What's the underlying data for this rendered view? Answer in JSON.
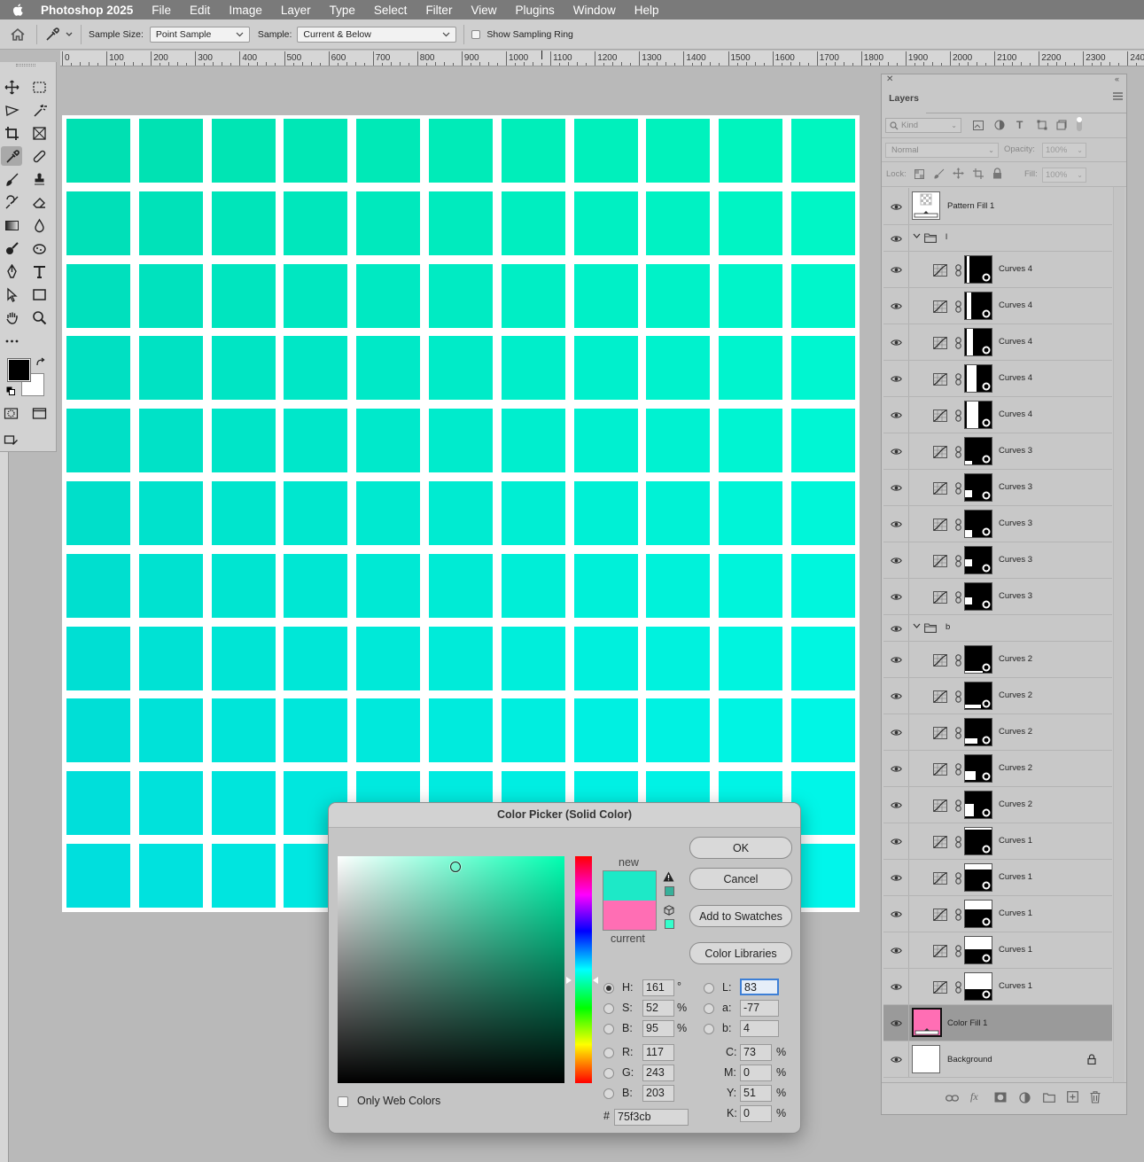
{
  "menubar": {
    "app": "Photoshop 2025",
    "items": [
      "File",
      "Edit",
      "Image",
      "Layer",
      "Type",
      "Select",
      "Filter",
      "View",
      "Plugins",
      "Window",
      "Help"
    ]
  },
  "options": {
    "sample_size_label": "Sample Size:",
    "sample_size_value": "Point Sample",
    "sample_label": "Sample:",
    "sample_value": "Current & Below",
    "sampling_ring_label": "Show Sampling Ring"
  },
  "ruler": {
    "labels": [
      "0",
      "100",
      "200",
      "300",
      "400",
      "500",
      "600",
      "700",
      "800",
      "900",
      "1000",
      "1100",
      "1200",
      "1300",
      "1400",
      "1500",
      "1600",
      "1700",
      "1800",
      "1900",
      "2000",
      "2100",
      "2200",
      "2300",
      "240"
    ]
  },
  "canvas": {
    "grid_colors": [
      [
        "#00e0b2",
        "#00e2b3",
        "#00e5b4",
        "#00e7b6",
        "#00e9b7",
        "#00ebb8",
        "#00eeba",
        "#00f0bc",
        "#00f2bd",
        "#00f4be",
        "#00f6c0"
      ],
      [
        "#00e0b8",
        "#00e2b9",
        "#00e5ba",
        "#00e7bc",
        "#00e9bd",
        "#00ebbe",
        "#00eec0",
        "#00f0c2",
        "#00f2c3",
        "#00f4c4",
        "#00f6c6"
      ],
      [
        "#00e0bd",
        "#00e2be",
        "#00e5bf",
        "#00e7c1",
        "#00e9c2",
        "#00ebc3",
        "#00eec5",
        "#00f0c7",
        "#00f2c8",
        "#00f4c9",
        "#00f6cb"
      ],
      [
        "#00e0c2",
        "#00e2c3",
        "#00e5c4",
        "#00e7c6",
        "#00e9c7",
        "#00ebc8",
        "#00eeca",
        "#00f0cc",
        "#00f2cd",
        "#00f4ce",
        "#00f6d0"
      ],
      [
        "#00e0c6",
        "#00e2c7",
        "#00e5c8",
        "#00e7ca",
        "#00e9cb",
        "#00ebcc",
        "#00eece",
        "#00f0d0",
        "#00f2d1",
        "#00f4d2",
        "#00f6d4"
      ],
      [
        "#00dfca",
        "#00e2cc",
        "#00e5cd",
        "#00e7cf",
        "#00e9d0",
        "#00ebd1",
        "#00eed3",
        "#00f0d5",
        "#00f2d6",
        "#00f4d7",
        "#00f6d9"
      ],
      [
        "#00dfcf",
        "#00e2d0",
        "#00e5d1",
        "#00e7d3",
        "#00e9d4",
        "#00ebd5",
        "#00eed7",
        "#00f0d9",
        "#00f2da",
        "#00f4db",
        "#00f6dd"
      ],
      [
        "#00dfd3",
        "#00e2d4",
        "#00e5d5",
        "#00e7d7",
        "#00e9d8",
        "#00ebd9",
        "#00eedb",
        "#00f0dd",
        "#00f2de",
        "#00f4df",
        "#00f6e1"
      ],
      [
        "#00dfd6",
        "#00e2d8",
        "#00e5d9",
        "#00e7db",
        "#00e9dc",
        "#00ebdd",
        "#00eedf",
        "#00f0e1",
        "#00f2e2",
        "#00f4e3",
        "#00f6e5"
      ],
      [
        "#00dfda",
        "#00e2db",
        "#00e5dc",
        "#00e7de",
        "#00e9df",
        "#00ebe0",
        "#00eee2",
        "#00f0e4",
        "#00f2e5",
        "#00f4e6",
        "#00f6e8"
      ],
      [
        "#00dfdd",
        "#00e2de",
        "#00e5df",
        "#00e7e1",
        "#00e9e2",
        "#00ebe3",
        "#00eee5",
        "#00f0e7",
        "#00f2e8",
        "#00f4e9",
        "#00f6eb"
      ]
    ]
  },
  "layers_panel": {
    "tab": "Layers",
    "kind_label": "Kind",
    "blend_mode": "Normal",
    "opacity_label": "Opacity:",
    "opacity_value": "100%",
    "lock_label": "Lock:",
    "fill_label": "Fill:",
    "fill_value": "100%",
    "layers": [
      {
        "name": "Pattern Fill 1",
        "kind": "pattern"
      },
      {
        "name": "l",
        "kind": "group"
      },
      {
        "name": "Curves 4",
        "kind": "adj"
      },
      {
        "name": "Curves 4",
        "kind": "adj"
      },
      {
        "name": "Curves 4",
        "kind": "adj"
      },
      {
        "name": "Curves 4",
        "kind": "adj"
      },
      {
        "name": "Curves 4",
        "kind": "adj"
      },
      {
        "name": "Curves 3",
        "kind": "adj"
      },
      {
        "name": "Curves 3",
        "kind": "adj"
      },
      {
        "name": "Curves 3",
        "kind": "adj"
      },
      {
        "name": "Curves 3",
        "kind": "adj"
      },
      {
        "name": "Curves 3",
        "kind": "adj"
      },
      {
        "name": "b",
        "kind": "group"
      },
      {
        "name": "Curves 2",
        "kind": "adj"
      },
      {
        "name": "Curves 2",
        "kind": "adj"
      },
      {
        "name": "Curves 2",
        "kind": "adj"
      },
      {
        "name": "Curves 2",
        "kind": "adj"
      },
      {
        "name": "Curves 2",
        "kind": "adj"
      },
      {
        "name": "Curves 1",
        "kind": "adj"
      },
      {
        "name": "Curves 1",
        "kind": "adj"
      },
      {
        "name": "Curves 1",
        "kind": "adj"
      },
      {
        "name": "Curves 1",
        "kind": "adj"
      },
      {
        "name": "Curves 1",
        "kind": "adj"
      },
      {
        "name": "Color Fill 1",
        "kind": "colorfill",
        "selected": true
      },
      {
        "name": "Background",
        "kind": "background"
      }
    ]
  },
  "picker": {
    "title": "Color Picker (Solid Color)",
    "ok": "OK",
    "cancel": "Cancel",
    "add_swatches": "Add to Swatches",
    "color_libraries": "Color Libraries",
    "new_label": "new",
    "current_label": "current",
    "new_color": "#1de9c7",
    "current_color": "#ff6eb4",
    "hue_color": "#00ffb1",
    "only_web": "Only Web Colors",
    "hsb": {
      "h": "161",
      "h_unit": "°",
      "s": "52",
      "s_unit": "%",
      "b": "95",
      "b_unit": "%"
    },
    "rgb": {
      "r": "117",
      "g": "243",
      "b": "203"
    },
    "lab": {
      "l": "83",
      "a": "-77",
      "b": "4"
    },
    "cmyk": {
      "c": "73",
      "m": "0",
      "y": "51",
      "k": "0",
      "unit": "%"
    },
    "hex_label": "#",
    "hex": "75f3cb"
  }
}
